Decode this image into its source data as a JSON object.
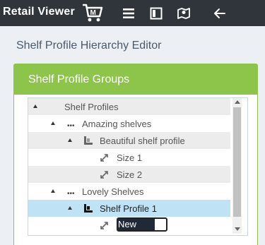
{
  "app": {
    "logo_text": "Retail Viewer",
    "logo_badge": "M"
  },
  "header": {
    "title": "Shelf Profile Hierarchy Editor"
  },
  "panel": {
    "title": "Shelf Profile Groups"
  },
  "tree": {
    "root": "Shelf Profiles",
    "group1": "Amazing shelves",
    "profile1": "Beautiful shelf profile",
    "size1": "Size 1",
    "size2": "Size 2",
    "group2": "Lovely Shelves",
    "profile2": "Shelf Profile 1",
    "new_item_value": "New Size"
  },
  "colors": {
    "topbar": "#2f353b",
    "panel_header": "#8dc44a",
    "selected_row": "#bfe3f5"
  }
}
